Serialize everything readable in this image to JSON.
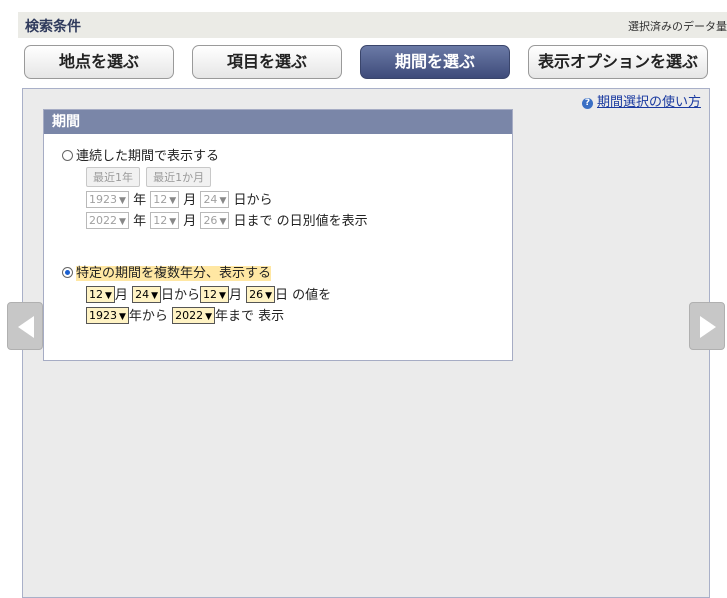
{
  "header": {
    "title": "検索条件",
    "right_text": "選択済みのデータ量"
  },
  "tabs": [
    {
      "label": "地点を選ぶ"
    },
    {
      "label": "項目を選ぶ"
    },
    {
      "label": "期間を選ぶ",
      "active": true
    },
    {
      "label": "表示オプションを選ぶ"
    }
  ],
  "help": {
    "link": "期間選択の使い方"
  },
  "period": {
    "title": "期間",
    "continuous": {
      "label": "連続した期間で表示する",
      "selected": false,
      "quick_buttons": [
        "最近1年",
        "最近1か月"
      ],
      "from": {
        "year": "1923",
        "month": "12",
        "day": "24",
        "suffix": "日から"
      },
      "to": {
        "year": "2022",
        "month": "12",
        "day": "26",
        "suffix": "日まで の日別値を表示"
      }
    },
    "specific": {
      "label": "特定の期間を複数年分、表示する",
      "selected": true,
      "start_month": "12",
      "start_day": "24",
      "end_month": "12",
      "end_day": "26",
      "text_from": "日から",
      "text_value": "日 の値を",
      "from_year": "1923",
      "to_year": "2022",
      "text_year_from": "年から",
      "text_year_to": "年まで 表示"
    },
    "units": {
      "year": "年",
      "month": "月"
    }
  },
  "nav": {
    "prev": "left-arrow",
    "next": "right-arrow"
  }
}
